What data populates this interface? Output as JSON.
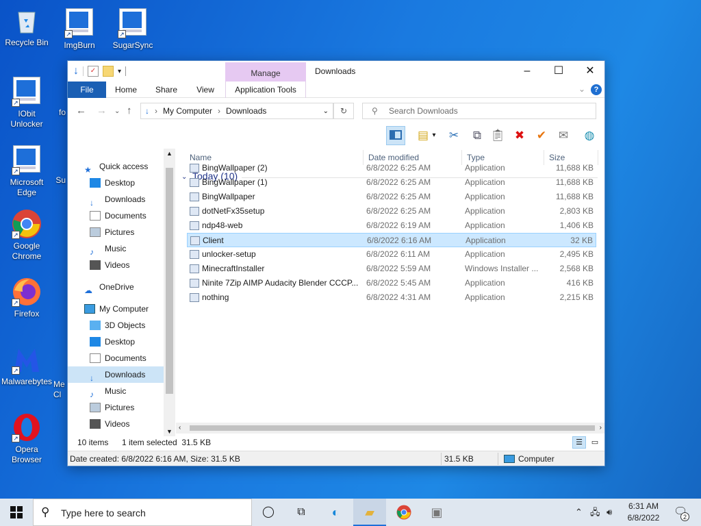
{
  "desktop": {
    "icons": [
      {
        "label": "Recycle Bin"
      },
      {
        "label": "ImgBurn"
      },
      {
        "label": "SugarSync"
      },
      {
        "label": "IObit Unlocker"
      },
      {
        "label": "fo"
      },
      {
        "label": "Microsoft Edge"
      },
      {
        "label": "Su"
      },
      {
        "label": "Google Chrome"
      },
      {
        "label": "Firefox"
      },
      {
        "label": "Malwarebytes"
      },
      {
        "label": "Me Cl"
      },
      {
        "label": "Opera Browser"
      }
    ]
  },
  "window": {
    "title": "Downloads",
    "manage_tab": "Manage",
    "ribbon_tabs": [
      "File",
      "Home",
      "Share",
      "View",
      "Application Tools"
    ],
    "address": {
      "root": "My Computer",
      "current": "Downloads"
    },
    "search_placeholder": "Search Downloads",
    "nav": {
      "quick_access": "Quick access",
      "quick_items": [
        "Desktop",
        "Downloads",
        "Documents",
        "Pictures",
        "Music",
        "Videos"
      ],
      "onedrive": "OneDrive",
      "my_computer": "My Computer",
      "computer_items": [
        "3D Objects",
        "Desktop",
        "Documents",
        "Downloads",
        "Music",
        "Pictures",
        "Videos"
      ]
    },
    "columns": [
      "Name",
      "Date modified",
      "Type",
      "Size"
    ],
    "group_label": "Today (10)",
    "files": [
      {
        "name": "BingWallpaper (2)",
        "date": "6/8/2022 6:25 AM",
        "type": "Application",
        "size": "11,688 KB"
      },
      {
        "name": "BingWallpaper (1)",
        "date": "6/8/2022 6:25 AM",
        "type": "Application",
        "size": "11,688 KB"
      },
      {
        "name": "BingWallpaper",
        "date": "6/8/2022 6:25 AM",
        "type": "Application",
        "size": "11,688 KB"
      },
      {
        "name": "dotNetFx35setup",
        "date": "6/8/2022 6:25 AM",
        "type": "Application",
        "size": "2,803 KB"
      },
      {
        "name": "ndp48-web",
        "date": "6/8/2022 6:19 AM",
        "type": "Application",
        "size": "1,406 KB"
      },
      {
        "name": "Client",
        "date": "6/8/2022 6:16 AM",
        "type": "Application",
        "size": "32 KB"
      },
      {
        "name": "unlocker-setup",
        "date": "6/8/2022 6:11 AM",
        "type": "Application",
        "size": "2,495 KB"
      },
      {
        "name": "MinecraftInstaller",
        "date": "6/8/2022 5:59 AM",
        "type": "Windows Installer ...",
        "size": "2,568 KB"
      },
      {
        "name": "Ninite 7Zip AIMP Audacity Blender CCCP...",
        "date": "6/8/2022 5:45 AM",
        "type": "Application",
        "size": "416 KB"
      },
      {
        "name": "nothing",
        "date": "6/8/2022 4:31 AM",
        "type": "Application",
        "size": "2,215 KB"
      }
    ],
    "selected_file_index": 5,
    "status": {
      "count": "10 items",
      "selection": "1 item selected  31.5 KB"
    },
    "details_bar": {
      "info": "Date created: 6/8/2022 6:16 AM, Size: 31.5 KB",
      "size": "31.5 KB",
      "location": "Computer"
    }
  },
  "taskbar": {
    "search_placeholder": "Type here to search",
    "time": "6:31 AM",
    "date": "6/8/2022",
    "notification_count": "2"
  },
  "colors": {
    "accent": "#1a5fb4",
    "selection": "#cce8ff",
    "manage_tab": "#e6c9f2",
    "desktop": "#1a7ae0"
  }
}
